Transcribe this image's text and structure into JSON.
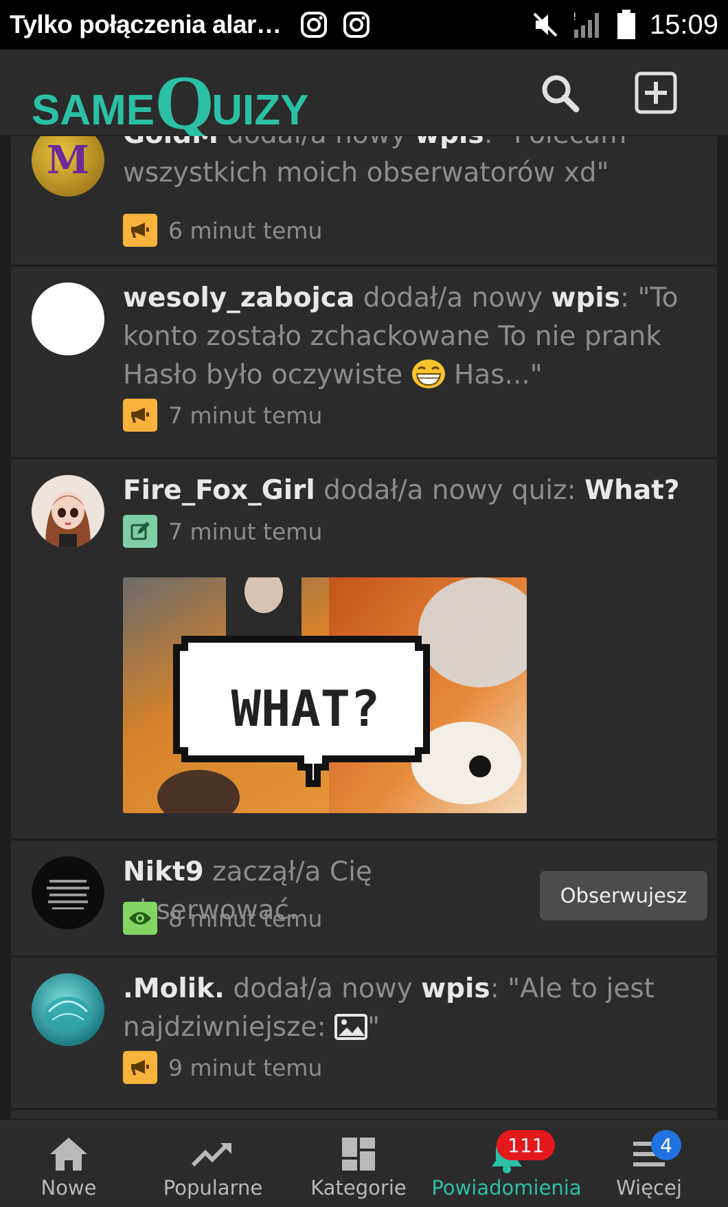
{
  "status_bar": {
    "carrier_text": "Tylko połączenia alar…",
    "time": "15:09",
    "icons": [
      "instagram-icon",
      "instagram-icon",
      "mute-icon",
      "signal-icon",
      "battery-icon"
    ]
  },
  "header": {
    "logo": {
      "same": "SAME",
      "q": "Q",
      "uizy": "UIZY"
    },
    "icons": [
      "search-icon",
      "add-icon"
    ],
    "accent_color": "#2bc0a6"
  },
  "feed": [
    {
      "user": "GoldM",
      "action": " dodał/a nowy ",
      "object": "wpis",
      "text_before": ": \"Polecam wszystkich moich obserwatorów xd\"",
      "time": "6 minut temu",
      "badge_icon": "megaphone-icon",
      "badge_color": "#f8b33c"
    },
    {
      "user": "wesoly_zabojca",
      "action": " dodał/a nowy ",
      "object": "wpis",
      "text_before": ": \"To konto zostało zchackowane To nie prank Hasło było oczywiste ",
      "text_after": " Has...\"",
      "time": "7 minut temu",
      "badge_icon": "megaphone-icon",
      "badge_color": "#f8b33c"
    },
    {
      "user": "Fire_Fox_Girl",
      "action": " dodał/a nowy quiz: ",
      "quiz_title": "What?",
      "time": "7 minut temu",
      "badge_icon": "edit-icon",
      "badge_color": "#7fcfa6",
      "thumbnail_text": "WHAT?"
    },
    {
      "user": "Nikt9",
      "action": " zaczął/a Cię obserwować.",
      "time": "8 minut temu",
      "badge_icon": "eye-icon",
      "badge_color": "#84d564",
      "button_label": "Obserwujesz"
    },
    {
      "user": ".Molik.",
      "action": " dodał/a nowy ",
      "object": "wpis",
      "text_before": ": \"Ale to jest najdziwniejsze: ",
      "text_after": "\"",
      "time": "9 minut temu",
      "badge_icon": "megaphone-icon",
      "badge_color": "#f8b33c"
    }
  ],
  "bottom_nav": {
    "items": [
      {
        "label": "Nowe",
        "icon": "home-icon"
      },
      {
        "label": "Popularne",
        "icon": "trending-icon"
      },
      {
        "label": "Kategorie",
        "icon": "dashboard-icon"
      },
      {
        "label": "Powiadomienia",
        "icon": "bell-icon",
        "count": "111",
        "active": true
      },
      {
        "label": "Więcej",
        "icon": "menu-icon",
        "count": "4"
      }
    ]
  }
}
